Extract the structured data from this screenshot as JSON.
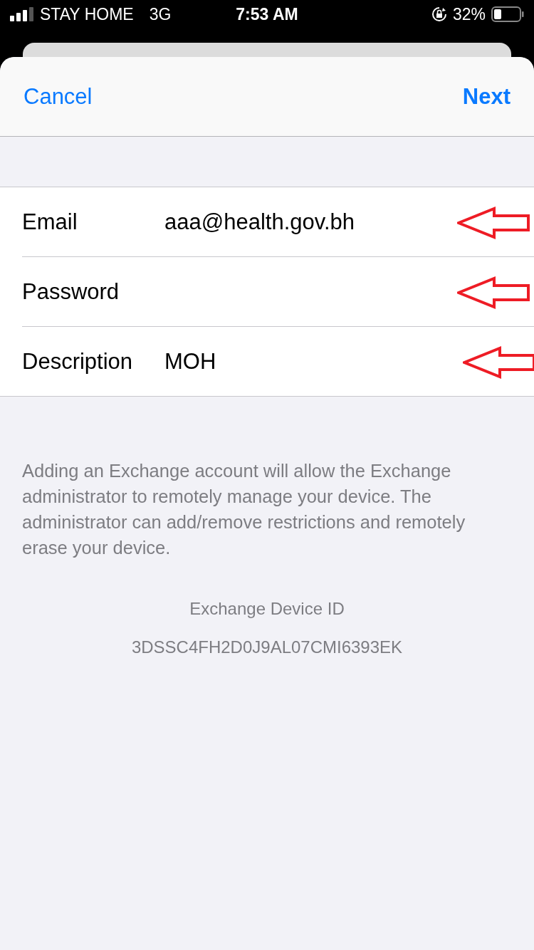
{
  "status_bar": {
    "carrier": "STAY HOME",
    "network": "3G",
    "time": "7:53 AM",
    "battery": "32%"
  },
  "nav_bar": {
    "left": "Cancel",
    "right": "Next"
  },
  "fields": [
    {
      "label": "Email",
      "value": "aaa@health.gov.bh"
    },
    {
      "label": "Password"
    },
    {
      "label": "Description",
      "value": "MOH"
    }
  ],
  "notice": "Adding an Exchange account will allow the Exchange administrator to remotely manage your device. The administrator can add/remove restrictions and remotely erase your device.",
  "device_id": {
    "title": "Exchange Device ID",
    "value": "3DSSC4FH2D0J9AL07CMI6393EK"
  }
}
